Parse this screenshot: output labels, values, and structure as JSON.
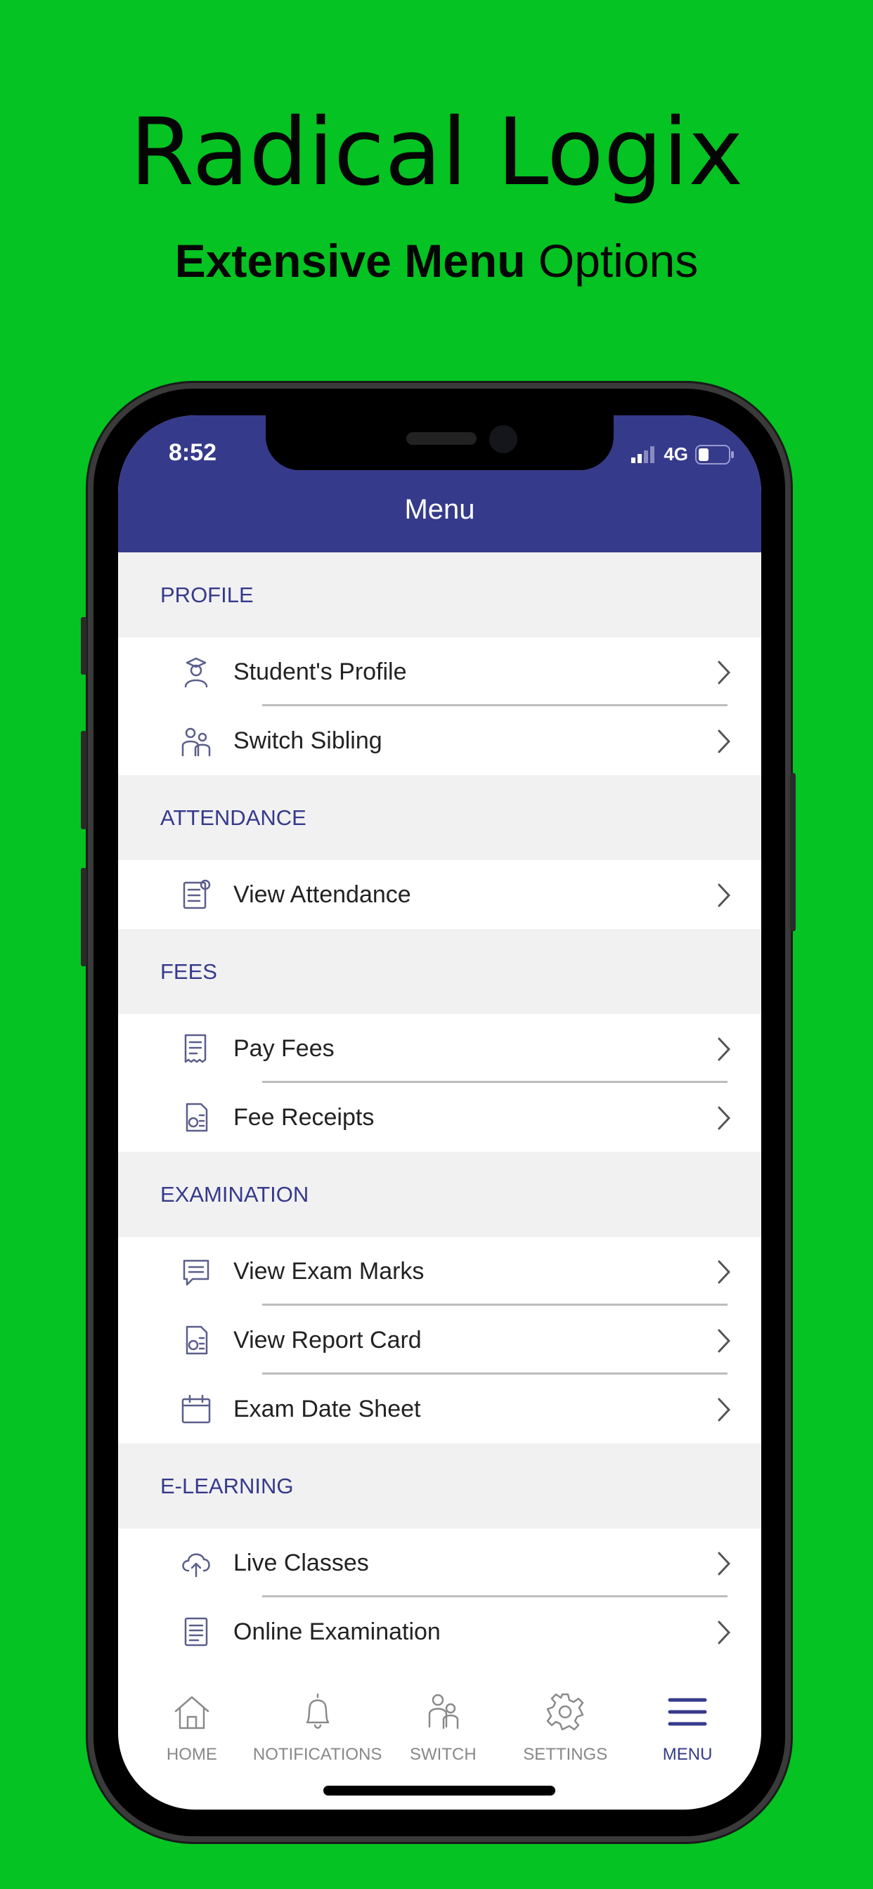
{
  "promo": {
    "title": "Radical Logix",
    "subtitle_bold": "Extensive  Menu",
    "subtitle_rest": " Options"
  },
  "status_bar": {
    "time": "8:52",
    "network": "4G"
  },
  "header": {
    "title": "Menu"
  },
  "sections": [
    {
      "label": "PROFILE",
      "items": [
        {
          "label": "Student's Profile",
          "icon": "graduate-icon"
        },
        {
          "label": "Switch Sibling",
          "icon": "siblings-icon"
        }
      ]
    },
    {
      "label": "ATTENDANCE",
      "items": [
        {
          "label": "View Attendance",
          "icon": "attendance-icon"
        }
      ]
    },
    {
      "label": "FEES",
      "items": [
        {
          "label": "Pay Fees",
          "icon": "receipt-icon"
        },
        {
          "label": "Fee Receipts",
          "icon": "document-icon"
        }
      ]
    },
    {
      "label": "EXAMINATION",
      "items": [
        {
          "label": "View Exam Marks",
          "icon": "chat-icon"
        },
        {
          "label": "View Report Card",
          "icon": "document-icon"
        },
        {
          "label": "Exam Date Sheet",
          "icon": "calendar-icon"
        }
      ]
    },
    {
      "label": "E-LEARNING",
      "items": [
        {
          "label": "Live Classes",
          "icon": "cloud-upload-icon"
        },
        {
          "label": "Online Examination",
          "icon": "notes-icon"
        }
      ]
    }
  ],
  "tabs": [
    {
      "label": "HOME",
      "icon": "home-icon"
    },
    {
      "label": "NOTIFICATIONS",
      "icon": "bell-icon"
    },
    {
      "label": "SWITCH",
      "icon": "users-icon"
    },
    {
      "label": "SETTINGS",
      "icon": "gear-icon"
    },
    {
      "label": "MENU",
      "icon": "hamburger-icon",
      "active": true
    }
  ],
  "colors": {
    "background": "#05c322",
    "header": "#363a8b",
    "section_bg": "#f1f1f2",
    "accent": "#363a8b"
  }
}
